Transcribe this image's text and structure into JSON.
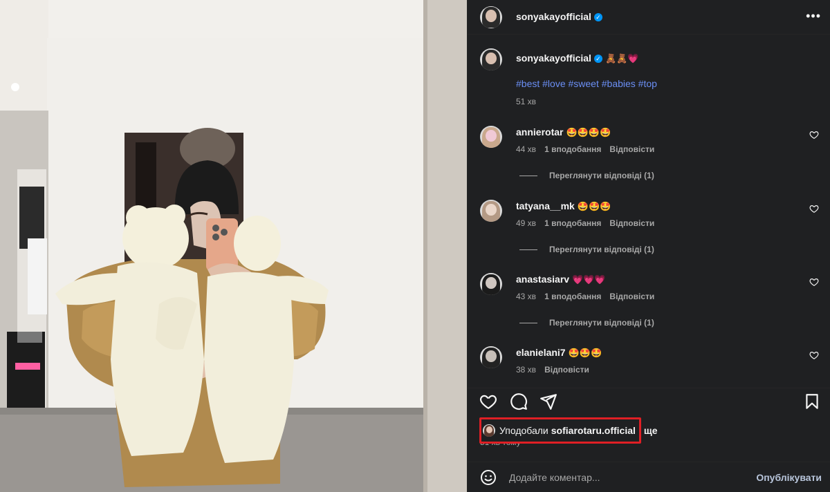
{
  "post": {
    "author": "sonyakayofficial",
    "verified": true
  },
  "caption": {
    "author": "sonyakayofficial",
    "emojis": "🧸🧸💗",
    "hashtags": "#best #love #sweet #babies #top",
    "time": "51 хв"
  },
  "comments": [
    {
      "user": "annierotar",
      "emojis": "🤩🤩🤩🤩",
      "time": "44 хв",
      "likes": "1 вподобання",
      "reply_label": "Відповісти",
      "view_replies": "Переглянути відповіді (1)"
    },
    {
      "user": "tatyana__mk",
      "emojis": "🤩🤩🤩",
      "time": "49 хв",
      "likes": "1 вподобання",
      "reply_label": "Відповісти",
      "view_replies": "Переглянути відповіді (1)"
    },
    {
      "user": "anastasiarv",
      "emojis": "💗💗💗",
      "time": "43 хв",
      "likes": "1 вподобання",
      "reply_label": "Відповісти",
      "view_replies": "Переглянути відповіді (1)"
    },
    {
      "user": "elanielani7",
      "emojis": "🤩🤩🤩",
      "time": "38 хв",
      "reply_label": "Відповісти"
    }
  ],
  "likes_line": {
    "prefix": "Уподобали",
    "user": "sofiarotaru.official",
    "suffix": "ще"
  },
  "posted_ago": "51 хв тому",
  "comment_box": {
    "placeholder": "Додайте коментар...",
    "publish_label": "Опублікувати"
  },
  "icons": {
    "more": "more-dots-icon",
    "like": "heart-icon",
    "comment": "comment-bubble-icon",
    "share": "paper-plane-icon",
    "save": "bookmark-icon",
    "emoji": "smiley-icon"
  },
  "colors": {
    "panel_bg": "#1f2022",
    "hashtag": "#6b8ff5",
    "verified": "#0095f6",
    "highlight_box": "#e01f25",
    "publish": "#b9c6dc"
  }
}
